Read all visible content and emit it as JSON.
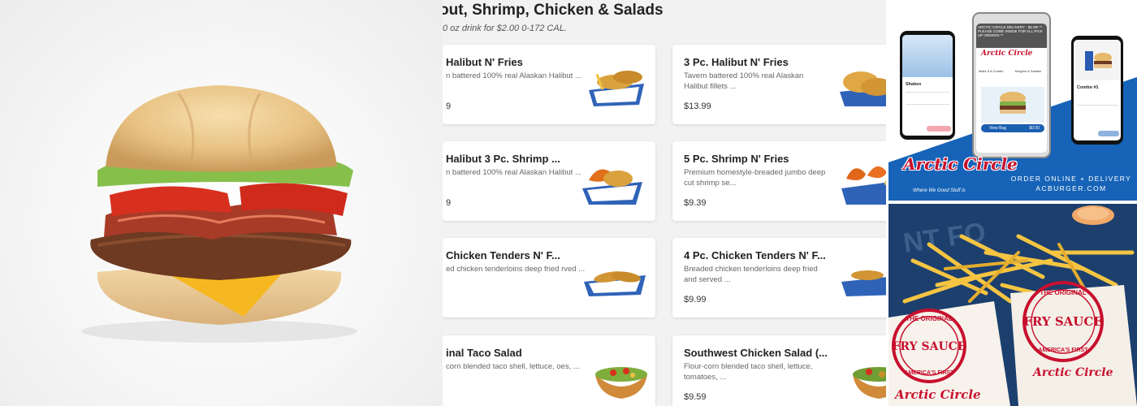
{
  "menu": {
    "title": "out, Shrimp, Chicken & Salads",
    "subtitle": "0 oz drink for $2.00 0-172 CAL.",
    "items": [
      {
        "name": "Halibut N' Fries",
        "desc": "n battered 100% real Alaskan Halibut ...",
        "price": "9"
      },
      {
        "name": "3 Pc. Halibut N' Fries",
        "desc": "Tavern battered 100% real Alaskan Halibut fillets ...",
        "price": "$13.99"
      },
      {
        "name": "Halibut 3 Pc. Shrimp ...",
        "desc": "n battered 100% real Alaskan Halibut ...",
        "price": "9"
      },
      {
        "name": "5 Pc. Shrimp N' Fries",
        "desc": "Premium homestyle-breaded jumbo deep cut shrimp se...",
        "price": "$9.39"
      },
      {
        "name": "Chicken Tenders N' F...",
        "desc": "ed chicken tenderloins deep fried rved ...",
        "price": ""
      },
      {
        "name": "4 Pc. Chicken Tenders N' F...",
        "desc": "Breaded chicken tenderloins deep fried and served ...",
        "price": "$9.99"
      },
      {
        "name": "inal Taco Salad",
        "desc": "corn blended taco shell, lettuce, oes, ...",
        "price": ""
      },
      {
        "name": "Southwest Chicken Salad (...",
        "desc": "Flour-corn blended taco shell, lettuce, tomatoes, ...",
        "price": "$9.59"
      }
    ]
  },
  "promo": {
    "brand": "Arctic Circle",
    "brand_slogan": "Where We Good Stuff is",
    "tagline_1": "ORDER ONLINE + DELIVERY",
    "tagline_2": "ACBURGER.COM",
    "phone_banner": "ARCTIC CIRCLE DELIVERY - $2.99! ** PLEASE COME INSIDE FOR ALL PICK UP ORDERS **",
    "phone_left_label": "Shakes",
    "phone_right_label": "Combo #1",
    "phone_mid_button": "View Bag",
    "phone_mid_price": "$0.00",
    "phone_mid_tab1": "Make It A Combo",
    "phone_mid_tab2": "Burgers & Sandwi"
  },
  "fries_photo": {
    "sauce_top": "THE ORIGINAL",
    "sauce_main": "FRY SAUCE",
    "sauce_bottom": "AMERICA'S FIRST",
    "brand": "Arctic Circle"
  }
}
